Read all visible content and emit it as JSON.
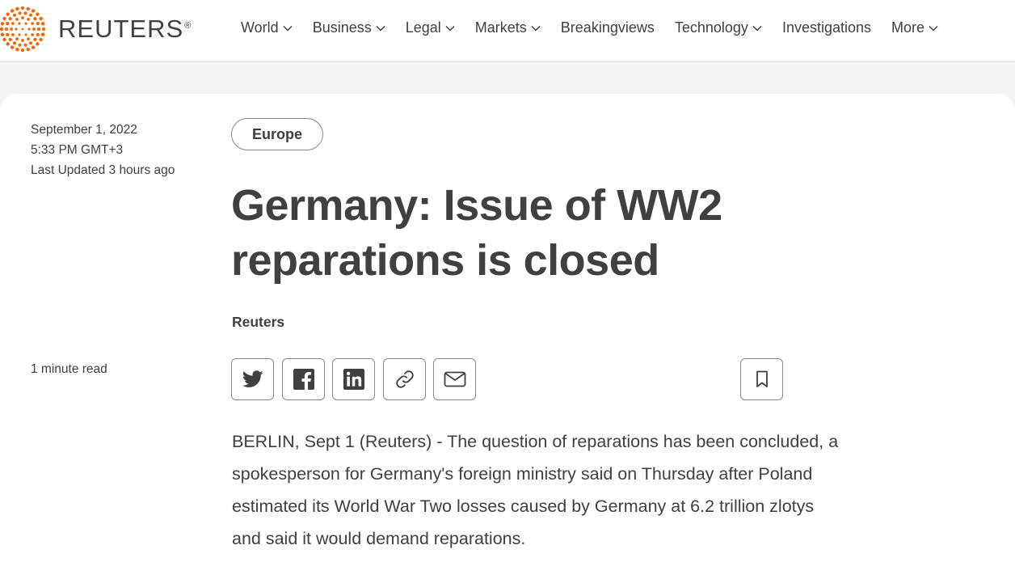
{
  "header": {
    "logo_text": "REUTERS",
    "logo_reg": "®",
    "logo_color": "#fa6400",
    "nav": [
      {
        "label": "World",
        "dropdown": true
      },
      {
        "label": "Business",
        "dropdown": true
      },
      {
        "label": "Legal",
        "dropdown": true
      },
      {
        "label": "Markets",
        "dropdown": true
      },
      {
        "label": "Breakingviews",
        "dropdown": false
      },
      {
        "label": "Technology",
        "dropdown": true
      },
      {
        "label": "Investigations",
        "dropdown": false
      },
      {
        "label": "More",
        "dropdown": true
      }
    ]
  },
  "article": {
    "date": "September 1, 2022",
    "time": "5:33 PM GMT+3",
    "updated": "Last Updated 3 hours ago",
    "tag": "Europe",
    "headline_line1": "Germany: Issue of WW2",
    "headline_line2": "reparations is closed",
    "byline": "Reuters",
    "read_time": "1 minute read",
    "share_icons": [
      "twitter-icon",
      "facebook-icon",
      "linkedin-icon",
      "link-icon",
      "email-icon"
    ],
    "bookmark_icon": "bookmark-icon",
    "body_line1": "BERLIN, Sept 1 (Reuters) - The question of reparations has been concluded, a",
    "body_line2": "spokesperson for Germany's foreign ministry said on Thursday after Poland",
    "body_line3": "estimated its World War Two losses caused by Germany at 6.2 trillion zlotys",
    "body_line4": "and said it would demand reparations."
  }
}
